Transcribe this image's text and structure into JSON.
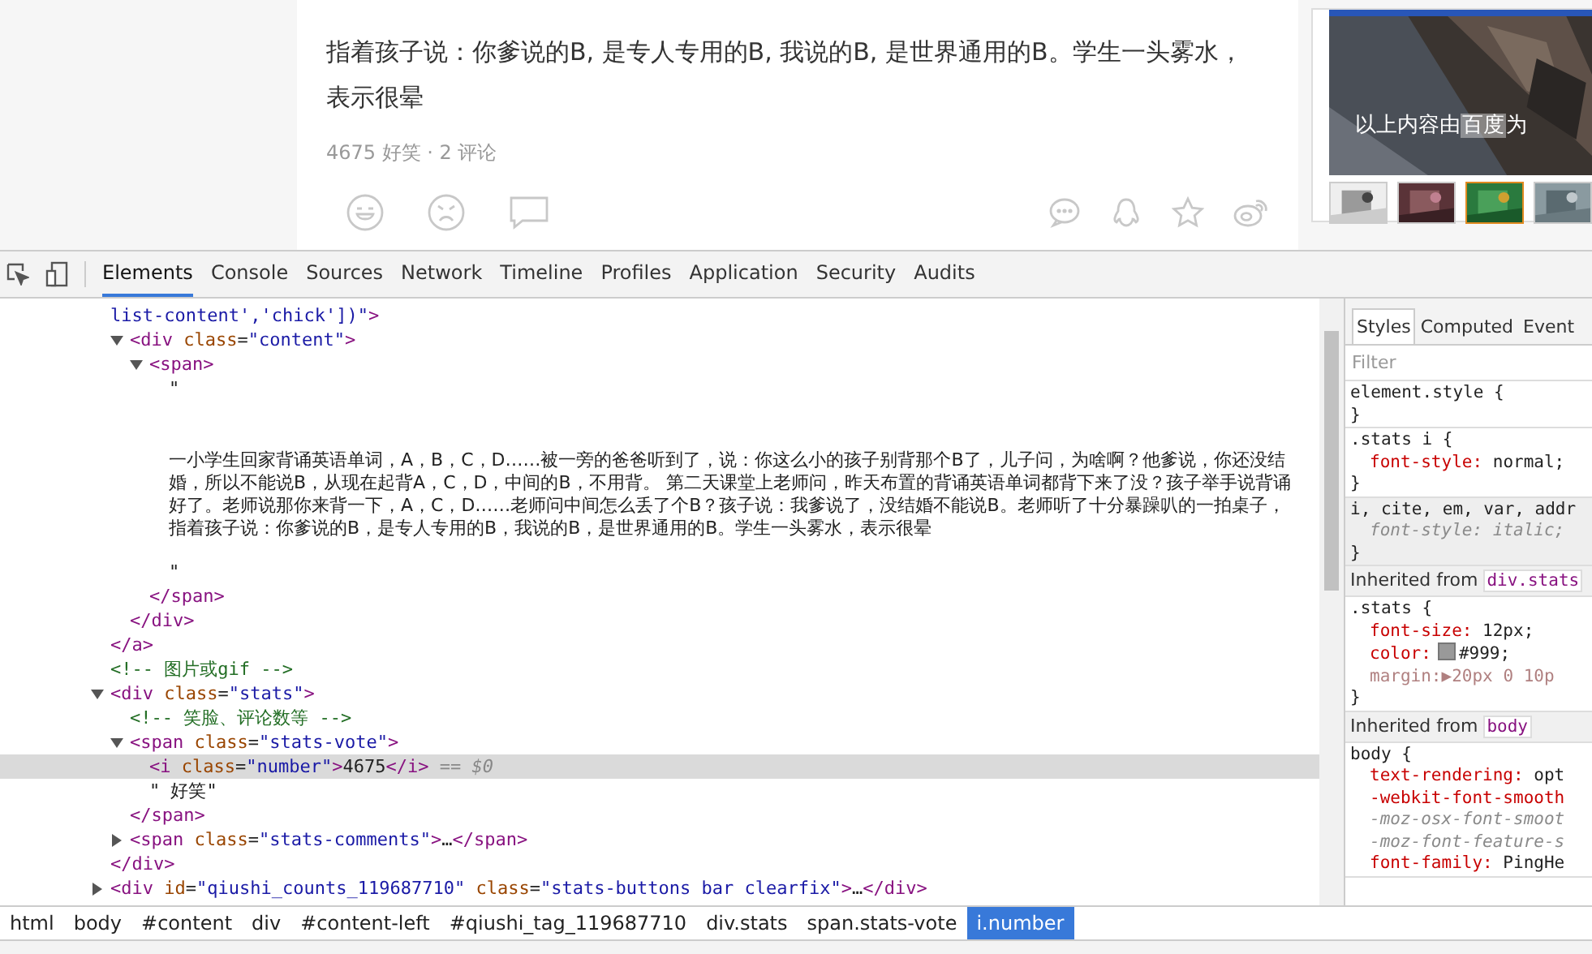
{
  "article": {
    "lines": [
      "指着孩子说：你爹说的B, 是专人专用的B, 我说的B, 是世界通用的B。学生一头雾水，",
      "表示很晕"
    ],
    "stats": "4675 好笑 · 2 评论"
  },
  "sidebar": {
    "ad_label": [
      {
        "s": "以上内容由",
        "highlight": false
      },
      {
        "s": "百度",
        "highlight": true
      },
      {
        "s": "为",
        "highlight": false
      }
    ],
    "thumbnails": [
      {
        "kind": "picture",
        "selected": false
      },
      {
        "kind": "picture",
        "selected": false
      },
      {
        "kind": "picture",
        "selected": true
      },
      {
        "kind": "picture",
        "selected": false
      }
    ]
  },
  "devtools": {
    "tabs": [
      {
        "label": "Elements",
        "selected": true
      },
      {
        "label": "Console",
        "selected": false
      },
      {
        "label": "Sources",
        "selected": false
      },
      {
        "label": "Network",
        "selected": false
      },
      {
        "label": "Timeline",
        "selected": false
      },
      {
        "label": "Profiles",
        "selected": false
      },
      {
        "label": "Application",
        "selected": false
      },
      {
        "label": "Security",
        "selected": false
      },
      {
        "label": "Audits",
        "selected": false
      }
    ],
    "dom_tree": [
      {
        "parts": [
          {
            "kind": "value",
            "s": "list-content','chick'])\""
          },
          {
            "kind": "tag",
            "s": ">"
          }
        ],
        "selected": false,
        "children": [
          {
            "parts": [
              {
                "kind": "tag",
                "s": "<div"
              },
              {
                "kind": "attr",
                "s": " class"
              },
              {
                "kind": "punct",
                "s": "="
              },
              {
                "kind": "value",
                "s": "\"content\""
              },
              {
                "kind": "tag",
                "s": ">"
              }
            ],
            "expanded": true,
            "selected": false,
            "children": [
              {
                "parts": [
                  {
                    "kind": "tag",
                    "s": "<span>"
                  }
                ],
                "expanded": true,
                "selected": false,
                "children": [
                  {
                    "parts": [
                      {
                        "kind": "text",
                        "s": "\""
                      }
                    ],
                    "selected": false
                  },
                  {
                    "parts": [
                      {
                        "kind": "para",
                        "s": "一小学生回家背诵英语单词，A，B，C，D……被一旁的爸爸听到了，说：你这么小的孩子别背那个B了，儿子问，为啥啊？他爹说，你还没结婚，所以不能说B，从现在起背A，C，D，中间的B，不用背。 第二天课堂上老师问，昨天布置的背诵英语单词都背下来了没？孩子举手说背诵好了。老师说那你来背一下，A，C，D……老师问中间怎么丢了个B？孩子说：我爹说了，没结婚不能说B。老师听了十分暴躁叭的一拍桌子，指着孩子说：你爹说的B，是专人专用的B，我说的B，是世界通用的B。学生一头雾水，表示很晕"
                      }
                    ],
                    "selected": false
                  },
                  {
                    "parts": [
                      {
                        "kind": "text",
                        "s": "\""
                      }
                    ],
                    "selected": false
                  }
                ],
                "close": [
                  {
                    "kind": "tag",
                    "s": "</span>"
                  }
                ]
              }
            ],
            "close": [
              {
                "kind": "tag",
                "s": "</div>"
              }
            ]
          }
        ],
        "close": [
          {
            "kind": "tag",
            "s": "</a>"
          }
        ]
      },
      {
        "parts": [
          {
            "kind": "comment",
            "s": "<!-- 图片或gif -->"
          }
        ],
        "selected": false
      },
      {
        "parts": [
          {
            "kind": "tag",
            "s": "<div"
          },
          {
            "kind": "attr",
            "s": " class"
          },
          {
            "kind": "punct",
            "s": "="
          },
          {
            "kind": "value",
            "s": "\"stats\""
          },
          {
            "kind": "tag",
            "s": ">"
          }
        ],
        "expanded": true,
        "selected": false,
        "children": [
          {
            "parts": [
              {
                "kind": "comment",
                "s": "<!-- 笑脸、评论数等 -->"
              }
            ],
            "selected": false
          },
          {
            "parts": [
              {
                "kind": "tag",
                "s": "<span"
              },
              {
                "kind": "attr",
                "s": " class"
              },
              {
                "kind": "punct",
                "s": "="
              },
              {
                "kind": "value",
                "s": "\"stats-vote\""
              },
              {
                "kind": "tag",
                "s": ">"
              }
            ],
            "expanded": true,
            "selected": false,
            "children": [
              {
                "parts": [
                  {
                    "kind": "tag",
                    "s": "<i"
                  },
                  {
                    "kind": "attr",
                    "s": " class"
                  },
                  {
                    "kind": "punct",
                    "s": "="
                  },
                  {
                    "kind": "value",
                    "s": "\"number\""
                  },
                  {
                    "kind": "tag",
                    "s": ">"
                  },
                  {
                    "kind": "text",
                    "s": "4675"
                  },
                  {
                    "kind": "tag",
                    "s": "</i>"
                  },
                  {
                    "kind": "hint",
                    "s": " == $0"
                  }
                ],
                "selected": true
              },
              {
                "parts": [
                  {
                    "kind": "text",
                    "s": "\" 好笑\""
                  }
                ],
                "selected": false
              }
            ],
            "close": [
              {
                "kind": "tag",
                "s": "</span>"
              }
            ]
          },
          {
            "parts": [
              {
                "kind": "tag",
                "s": "<span"
              },
              {
                "kind": "attr",
                "s": " class"
              },
              {
                "kind": "punct",
                "s": "="
              },
              {
                "kind": "value",
                "s": "\"stats-comments\""
              },
              {
                "kind": "tag",
                "s": ">"
              },
              {
                "kind": "text",
                "s": "…"
              },
              {
                "kind": "tag",
                "s": "</span>"
              }
            ],
            "expanded": false,
            "selected": false
          }
        ],
        "close": [
          {
            "kind": "tag",
            "s": "</div>"
          }
        ]
      },
      {
        "parts": [
          {
            "kind": "tag",
            "s": "<div"
          },
          {
            "kind": "attr",
            "s": " id"
          },
          {
            "kind": "punct",
            "s": "="
          },
          {
            "kind": "value",
            "s": "\"qiushi_counts_119687710\""
          },
          {
            "kind": "attr",
            "s": " class"
          },
          {
            "kind": "punct",
            "s": "="
          },
          {
            "kind": "value",
            "s": "\"stats-buttons bar clearfix\""
          },
          {
            "kind": "tag",
            "s": ">"
          },
          {
            "kind": "text",
            "s": "…"
          },
          {
            "kind": "tag",
            "s": "</div>"
          }
        ],
        "expanded": false,
        "selected": false
      }
    ],
    "breadcrumbs": [
      {
        "label": "html",
        "selected": false
      },
      {
        "label": "body",
        "selected": false
      },
      {
        "label": "#content",
        "selected": false
      },
      {
        "label": "div",
        "selected": false
      },
      {
        "label": "#content-left",
        "selected": false
      },
      {
        "label": "#qiushi_tag_119687710",
        "selected": false
      },
      {
        "label": "div.stats",
        "selected": false
      },
      {
        "label": "span.stats-vote",
        "selected": false
      },
      {
        "label": "i.number",
        "selected": true
      }
    ],
    "styles_tabs": [
      {
        "label": "Styles",
        "selected": true
      },
      {
        "label": "Computed",
        "selected": false
      },
      {
        "label": "Event",
        "selected": false
      }
    ],
    "filter": {
      "placeholder": "Filter"
    },
    "style_blocks": [
      {
        "kind": "rule",
        "selector": "element.style {",
        "user_agent": false,
        "close": "}"
      },
      {
        "kind": "rule",
        "selector": ".stats i {",
        "user_agent": false,
        "props": [
          {
            "name": "font-style:",
            "value": " normal;",
            "overridden": false,
            "dimmed": false
          }
        ],
        "close": "}"
      },
      {
        "kind": "rule",
        "selector": "i, cite, em, var, addr",
        "user_agent": true,
        "props": [
          {
            "name": "font-style:",
            "value": " italic;",
            "overridden": true,
            "dimmed": false
          }
        ],
        "close": "}"
      },
      {
        "kind": "inherited",
        "label": "Inherited from",
        "source": "div.stats"
      },
      {
        "kind": "rule",
        "selector": ".stats {",
        "user_agent": false,
        "props": [
          {
            "name": "font-size:",
            "value": " 12px;",
            "overridden": false,
            "dimmed": false
          },
          {
            "name": "color:",
            "value": "#999;",
            "color": "#999999",
            "overridden": false,
            "dimmed": false
          },
          {
            "name": "margin:",
            "value": "▶20px 0 10p",
            "overridden": false,
            "dimmed": true
          }
        ],
        "close": "}"
      },
      {
        "kind": "inherited",
        "label": "Inherited from",
        "source": "body"
      },
      {
        "kind": "rule",
        "selector": "body {",
        "user_agent": false,
        "props": [
          {
            "name": "text-rendering:",
            "value": " opt",
            "overridden": false,
            "dimmed": false
          },
          {
            "name": "-webkit-font-smooth",
            "overridden": false,
            "dimmed": false
          },
          {
            "name": "-moz-osx-font-smoot",
            "overridden": true,
            "dimmed": false
          },
          {
            "name": "-moz-font-feature-s",
            "overridden": true,
            "dimmed": false
          },
          {
            "name": "font-family:",
            "value": " PingHe",
            "overridden": false,
            "dimmed": false
          }
        ]
      }
    ]
  }
}
